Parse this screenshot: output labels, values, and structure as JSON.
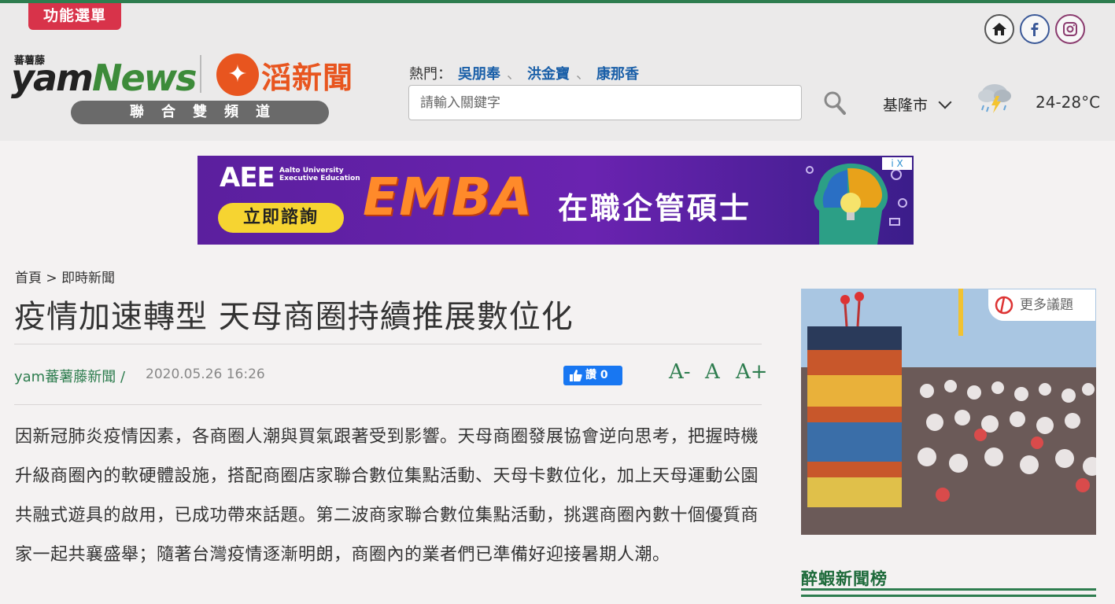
{
  "header": {
    "menu_label": "功能選單",
    "logo_small": "蕃薯藤",
    "logo_yam": "yam",
    "logo_news": "News",
    "logo_partner": "滔新聞",
    "channel_label": "聯合雙頻道",
    "hot_label": "熱門：",
    "hot_topics": [
      "吳朋奉",
      "洪金寶",
      "康那香"
    ],
    "hot_separator": "、",
    "search_placeholder": "請輸入關鍵字",
    "city": "基隆市",
    "temperature": "24-28°C",
    "social_icons": [
      "home-icon",
      "facebook-icon",
      "instagram-icon"
    ]
  },
  "ad": {
    "brand": "AEE",
    "partner": "Aalto University",
    "partner_sub": "Executive Education",
    "cta": "立即諮詢",
    "headline": "EMBA",
    "subline": "在職企管碩士",
    "badge": "i X"
  },
  "article": {
    "breadcrumb_home": "首頁",
    "breadcrumb_sep": ">",
    "breadcrumb_section": "即時新聞",
    "title": "疫情加速轉型 天母商圈持續推展數位化",
    "source": "yam蕃薯藤新聞 /",
    "date": "2020.05.26 16:26",
    "like_label": "讚 0",
    "font_smaller": "A-",
    "font_normal": "A",
    "font_larger": "A+",
    "body": "因新冠肺炎疫情因素，各商圈人潮與買氣跟著受到影響。天母商圈發展協會逆向思考，把握時機升級商圈內的軟硬體設施，搭配商圈店家聯合數位集點活動、天母卡數位化，加上天母運動公園共融式遊具的啟用，已成功帶來話題。第二波商家聯合數位集點活動，挑選商圈內數十個優質商家一起共襄盛舉；隨著台灣疫情逐漸明朗，商圈內的業者們已準備好迎接暑期人潮。"
  },
  "sidebar": {
    "more_label": "更多議題",
    "heading": "醉蝦新聞榜"
  },
  "colors": {
    "brand_green": "#2e7d4f",
    "menu_red": "#d8334a",
    "partner_orange": "#e8551f",
    "link_blue": "#1a5fa8"
  }
}
